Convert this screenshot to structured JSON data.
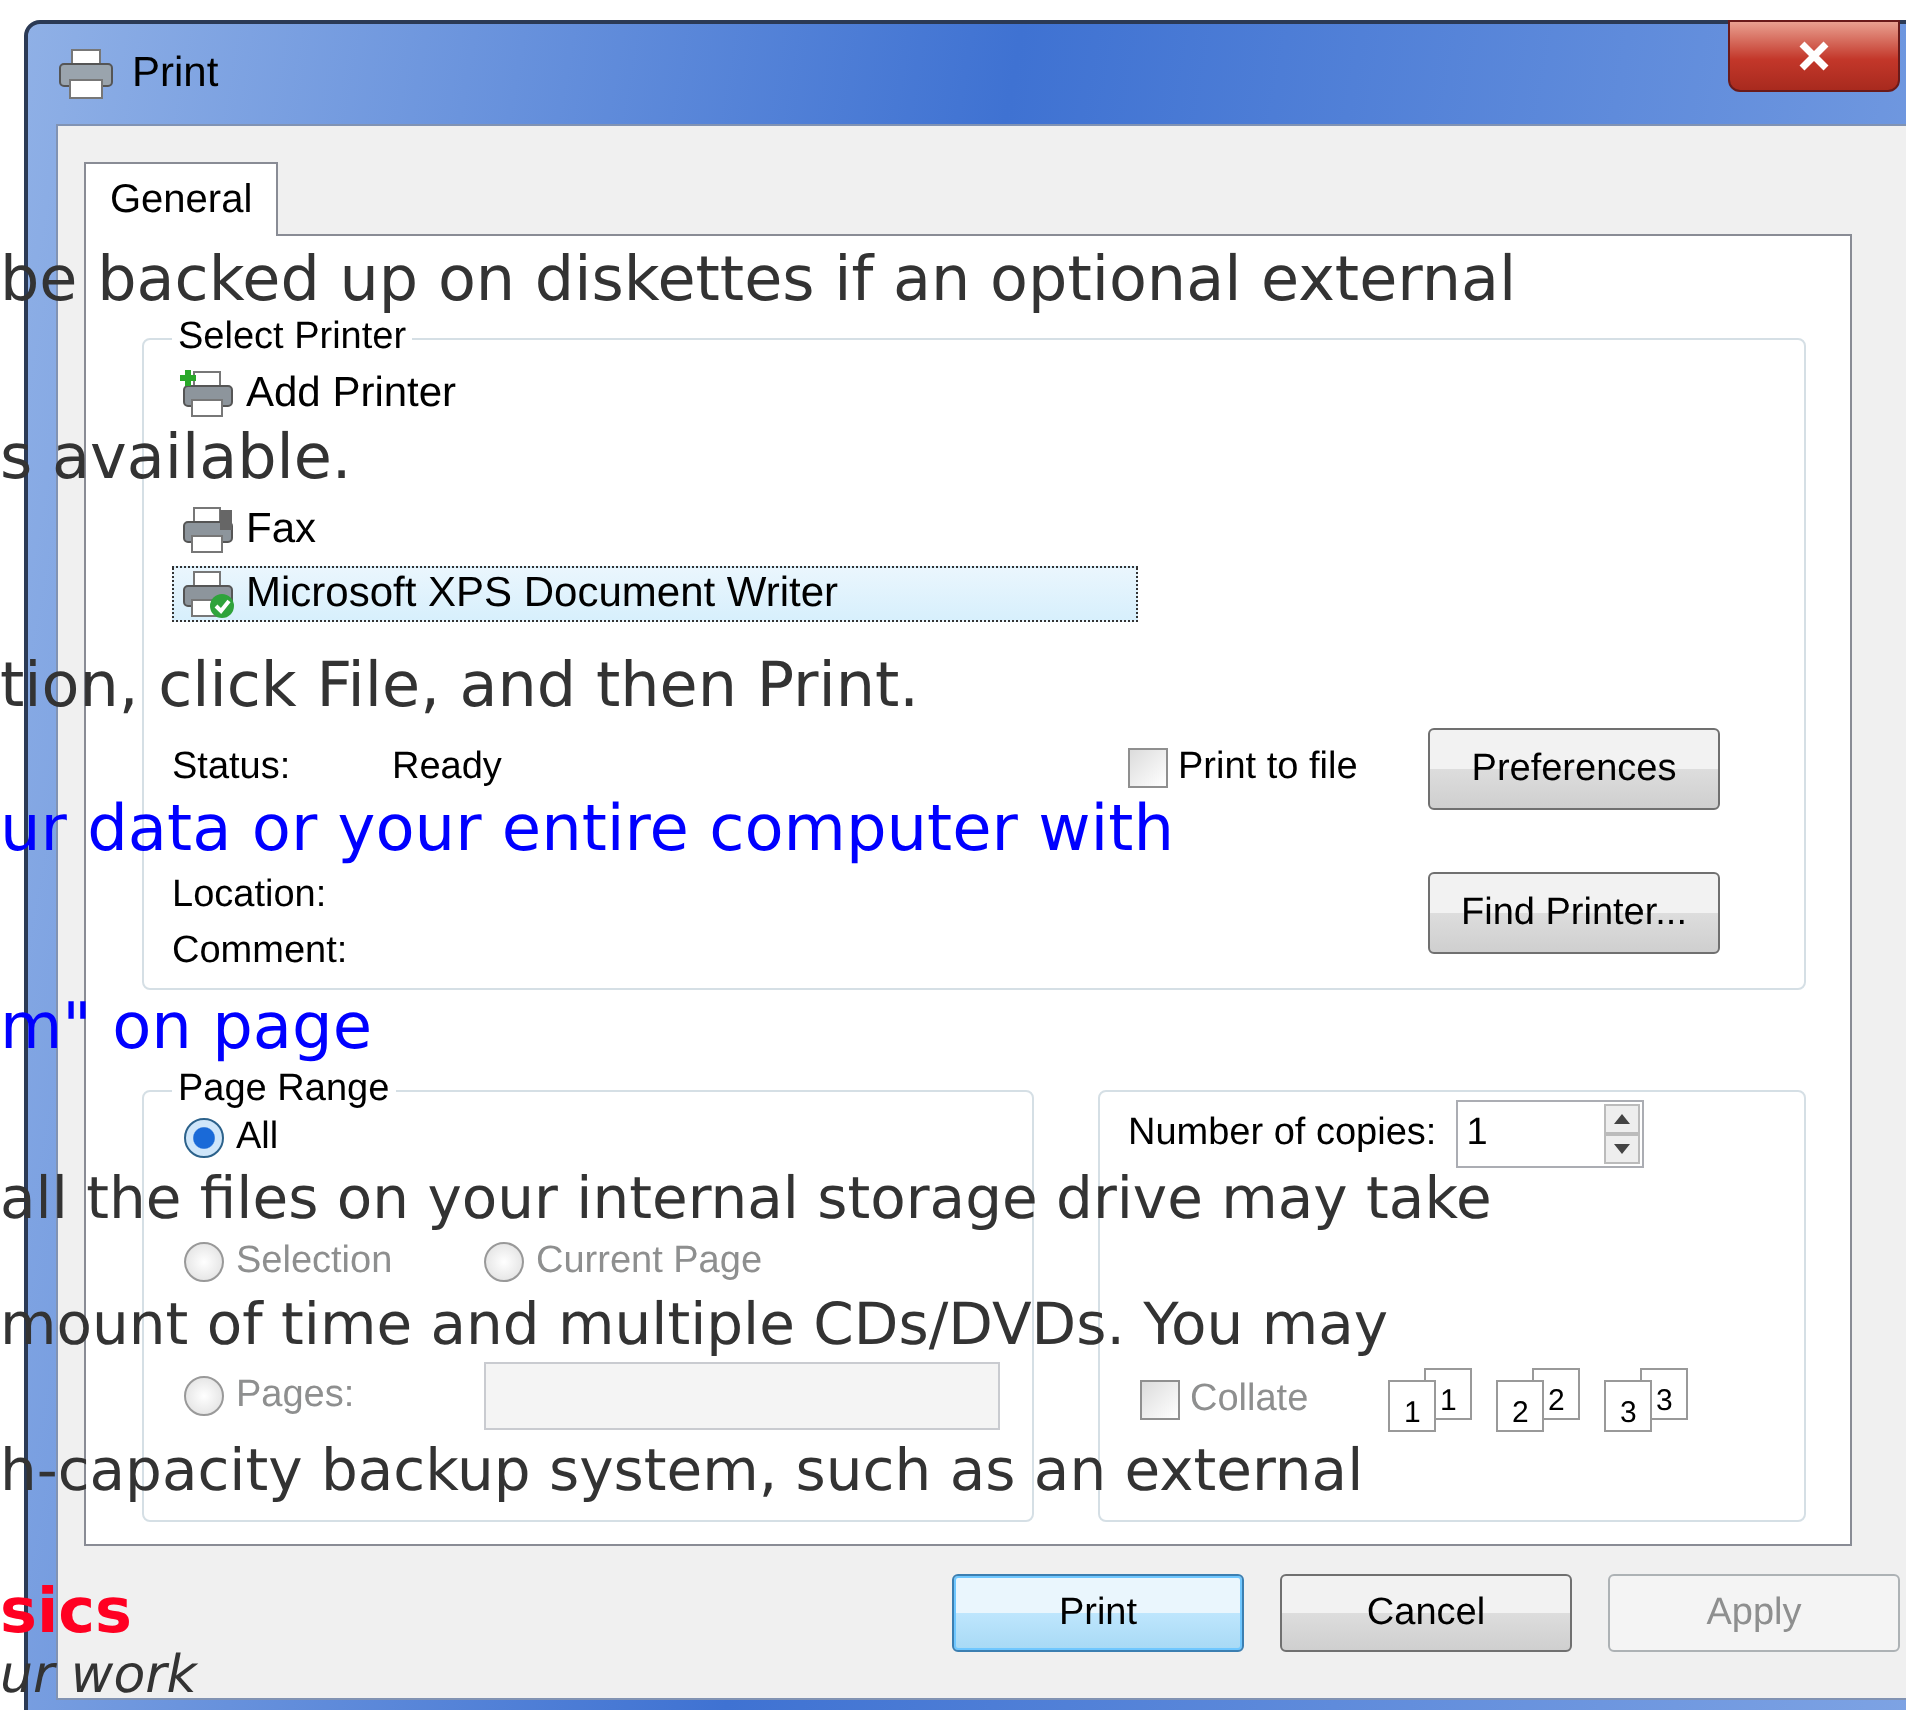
{
  "window": {
    "title": "Print"
  },
  "tabs": [
    {
      "label": "General",
      "selected": true
    }
  ],
  "select_printer": {
    "title": "Select Printer",
    "printers": [
      {
        "name": "Add Printer",
        "kind": "add",
        "selected": false
      },
      {
        "name": "Fax",
        "kind": "fax",
        "selected": false
      },
      {
        "name": "Microsoft XPS Document Writer",
        "kind": "default",
        "selected": true
      }
    ],
    "status_label": "Status:",
    "status": "Ready",
    "location_label": "Location:",
    "comment_label": "Comment:",
    "print_to_file": {
      "label": "Print to file",
      "checked": false
    },
    "buttons": [
      "Preferences",
      "Find Printer..."
    ]
  },
  "page_range": {
    "title": "Page Range",
    "options": [
      {
        "label": "All",
        "selected": true,
        "disabled": false
      },
      {
        "label": "Selection",
        "selected": false,
        "disabled": true
      },
      {
        "label": "Current Page",
        "selected": false,
        "disabled": true
      },
      {
        "label": "Pages:",
        "selected": false,
        "disabled": true
      }
    ]
  },
  "copies": {
    "label": "Number of copies:",
    "value": "1",
    "collate": {
      "label": "Collate",
      "checked": false,
      "disabled": true
    },
    "pages": [
      {
        "front": "1",
        "back": "1"
      },
      {
        "front": "2",
        "back": "2"
      },
      {
        "front": "3",
        "back": "3"
      }
    ]
  },
  "buttons": [
    {
      "label": "Print",
      "default": true,
      "disabled": false
    },
    {
      "label": "Cancel",
      "default": false,
      "disabled": false
    },
    {
      "label": "Apply",
      "default": false,
      "disabled": true
    }
  ],
  "background_text": [
    {
      "text": "be backed up on diskettes if an optional external",
      "kind": "body"
    },
    {
      "text": "s available.",
      "kind": "body"
    },
    {
      "text": "tion, click File, and then Print.",
      "kind": "body"
    },
    {
      "text": "ur data or your entire computer with",
      "kind": "link"
    },
    {
      "text": "m\" on page",
      "kind": "link"
    },
    {
      "text": "all the files on your internal storage drive may take",
      "kind": "small"
    },
    {
      "text": "mount of time and multiple CDs/DVDs. You may",
      "kind": "small"
    },
    {
      "text": "h-capacity backup system, such as an external",
      "kind": "small"
    },
    {
      "text": "sics",
      "kind": "heading"
    },
    {
      "text": "ur work",
      "kind": "italic"
    }
  ]
}
